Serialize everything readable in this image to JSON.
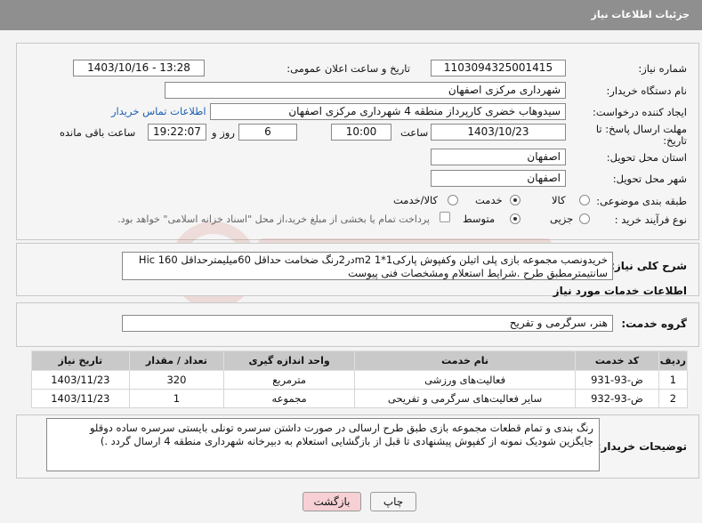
{
  "header": {
    "title": "جزئیات اطلاعات نیاز"
  },
  "form": {
    "need_number_label": "شماره نیاز:",
    "need_number": "1103094325001415",
    "announce_label": "تاریخ و ساعت اعلان عمومی:",
    "announce_value": "1403/10/16 - 13:28",
    "buyer_org_label": "نام دستگاه خریدار:",
    "buyer_org": "شهرداری مرکزی اصفهان",
    "creator_label": "ایجاد کننده درخواست:",
    "creator": "سیدوهاب خضری کارپرداز منطقه 4 شهرداری مرکزی اصفهان",
    "contact_link": "اطلاعات تماس خریدار",
    "deadline_label_1": "مهلت ارسال پاسخ: تا",
    "deadline_label_2": "تاریخ:",
    "deadline_date": "1403/10/23",
    "hour_label": "ساعت",
    "deadline_time": "10:00",
    "days": "6",
    "days_and_label": "روز و",
    "remaining_time": "19:22:07",
    "remaining_label": "ساعت باقی مانده",
    "province_label": "استان محل تحویل:",
    "province": "اصفهان",
    "city_label": "شهر محل تحویل:",
    "city": "اصفهان",
    "category_label": "طبقه بندی موضوعی:",
    "category_options": [
      "کالا",
      "خدمت",
      "کالا/خدمت"
    ],
    "category_selected": "خدمت",
    "process_label": "نوع فرآیند خرید :",
    "process_options": [
      "جزیی",
      "متوسط"
    ],
    "process_selected": "متوسط",
    "payment_note": "پرداخت تمام یا بخشی از مبلغ خرید،از محل \"اسناد خزانه اسلامی\" خواهد بود."
  },
  "summary": {
    "label": "شرح کلی نیاز:",
    "text": "خریدونصب مجموعه بازی پلی اتیلن وکفپوش پارکی1*1 m2در2رنگ ضخامت حداقل 60میلیمترحداقل Hic 160 سانتیمترمطبق طرح .شرایط استعلام ومشخصات فنی پیوست"
  },
  "services": {
    "title": "اطلاعات خدمات مورد نیاز",
    "group_label": "گروه خدمت:",
    "group_value": "هنر، سرگرمی و تفریح",
    "columns": [
      "ردیف",
      "کد خدمت",
      "نام خدمت",
      "واحد اندازه گیری",
      "تعداد / مقدار",
      "تاریخ نیاز"
    ],
    "rows": [
      {
        "row": "1",
        "code": "ض-93-931",
        "name": "فعالیت‌های ورزشی",
        "unit": "مترمربع",
        "qty": "320",
        "date": "1403/11/23"
      },
      {
        "row": "2",
        "code": "ض-93-932",
        "name": "سایر فعالیت‌های سرگرمی و تفریحی",
        "unit": "مجموعه",
        "qty": "1",
        "date": "1403/11/23"
      }
    ]
  },
  "buyer_notes": {
    "label": "توضیحات خریدار:",
    "text": "رنگ بندی و تمام قطعات مجموعه بازی طبق طرح ارسالی در صورت داشتن سرسره تونلی بایستی سرسره ساده دوقلو جایگزین شودیک نمونه از کفپوش پیشنهادی تا قبل از بازگشایی استعلام به دبیرخانه شهرداری منطقه 4 ارسال گردد .)"
  },
  "buttons": {
    "print": "چاپ",
    "back": "بازگشت"
  },
  "colors": {
    "header": "#8f8f8f",
    "link": "#1a5fb4",
    "back_button": "#f6d0d4",
    "table_header": "#c9c9c9"
  }
}
